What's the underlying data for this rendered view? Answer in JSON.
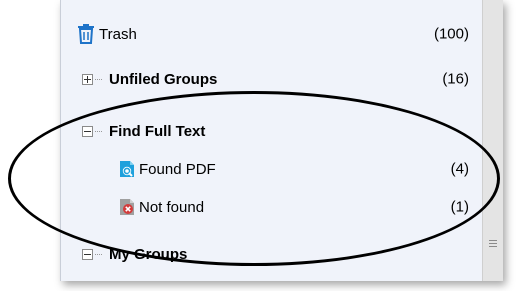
{
  "tree": {
    "trash": {
      "icon": "trash-icon",
      "label": "Trash",
      "count": "(100)"
    },
    "unfiled": {
      "label": "Unfiled Groups",
      "count": "(16)"
    },
    "find_full_text": {
      "label": "Find Full Text",
      "children": [
        {
          "icon": "found-pdf-icon",
          "label": "Found PDF",
          "count": "(4)"
        },
        {
          "icon": "not-found-icon",
          "label": "Not found",
          "count": "(1)"
        }
      ]
    },
    "my_groups": {
      "label": "My Groups"
    }
  },
  "colors": {
    "panel_bg": "#f0f3fa",
    "trash_icon": "#1e73c8",
    "doc_icon_blue": "#1ea0dc",
    "doc_icon_gray": "#a0a0a0",
    "error_red": "#d23b3b",
    "annotation_ring": "#000000"
  }
}
